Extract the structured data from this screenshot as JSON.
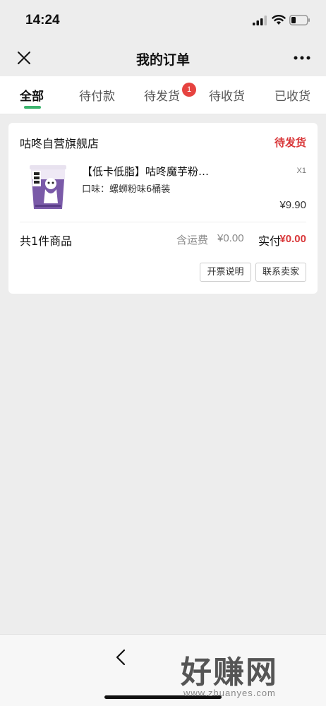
{
  "status_bar": {
    "time": "14:24"
  },
  "nav": {
    "title": "我的订单"
  },
  "tabs": [
    {
      "label": "全部",
      "active": true
    },
    {
      "label": "待付款"
    },
    {
      "label": "待发货",
      "badge": "1"
    },
    {
      "label": "待收货"
    },
    {
      "label": "已收货"
    }
  ],
  "order": {
    "shop_name": "咕咚自营旗舰店",
    "status": "待发货",
    "product": {
      "title": "【低卡低脂】咕咚魔芋粉…",
      "spec": "口味：螺蛳粉味6桶装",
      "quantity": "X1",
      "price": "¥9.90"
    },
    "summary": {
      "item_count": "共1件商品",
      "shipping_label": "含运费",
      "shipping_value": "¥0.00",
      "paid_label": "实付",
      "paid_value": "¥0.00"
    },
    "buttons": {
      "invoice": "开票说明",
      "contact": "联系卖家"
    }
  },
  "watermark": {
    "text": "好赚网",
    "url": "www.zhuanyes.com"
  },
  "colors": {
    "accent_green": "#3cb46e",
    "status_red": "#d9383a",
    "badge_red": "#e64340"
  }
}
